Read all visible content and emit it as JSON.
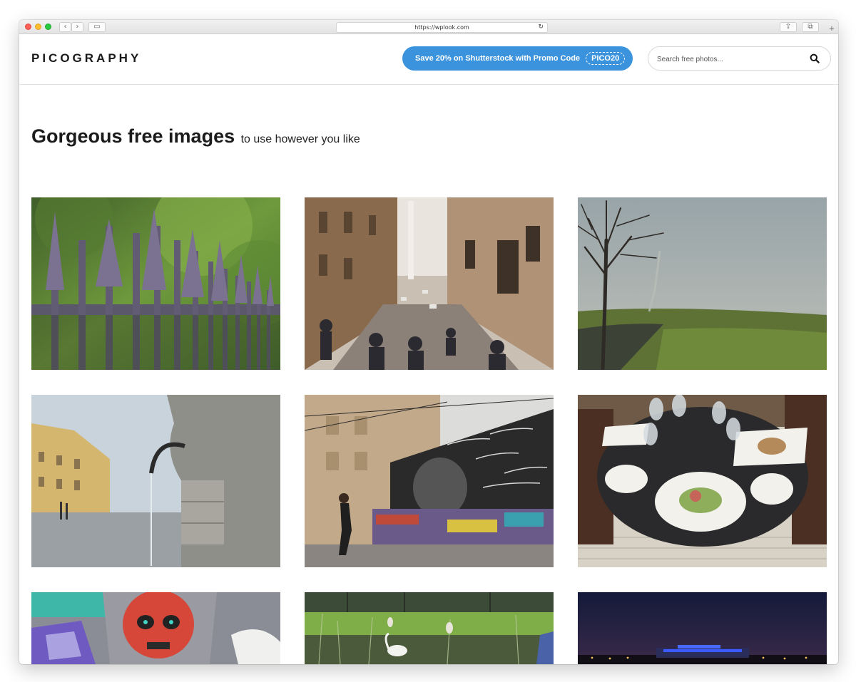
{
  "browser": {
    "url": "https://wplook.com",
    "buttons": {
      "back": "‹",
      "forward": "›",
      "sidebar": "▭",
      "reload": "↻",
      "share": "⇪",
      "tabs": "⧉",
      "new_tab": "+"
    }
  },
  "site": {
    "logo": "PICOGRAPHY",
    "promo": {
      "label": "Save 20% on Shutterstock with Promo Code",
      "code": "PICO20"
    },
    "search": {
      "placeholder": "Search free photos..."
    }
  },
  "hero": {
    "title": "Gorgeous free images",
    "subtitle": "to use however you like"
  },
  "colors": {
    "accent": "#3a93dc",
    "text": "#1b1b1b"
  }
}
